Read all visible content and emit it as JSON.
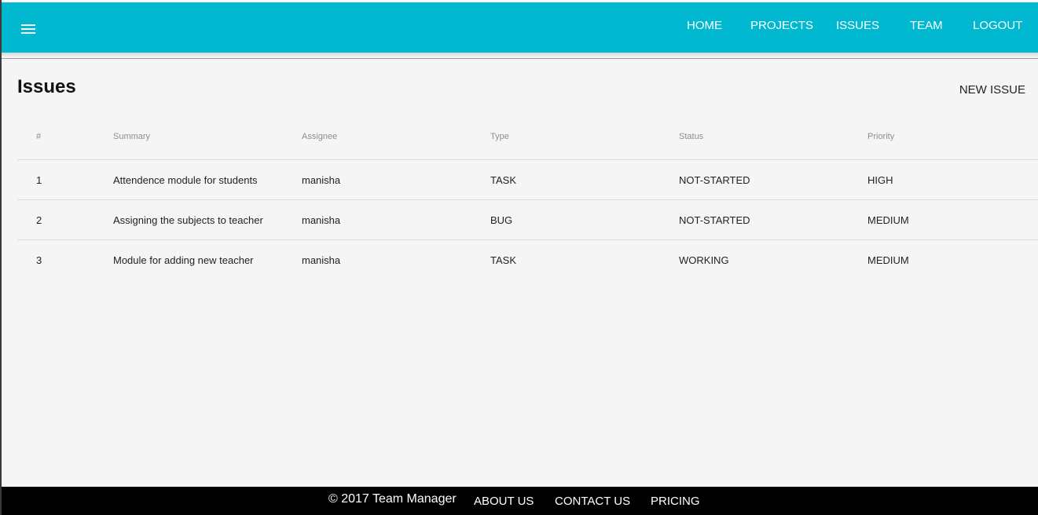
{
  "header": {
    "menu_icon": "hamburger-menu-icon",
    "nav": [
      "HOME",
      "PROJECTS",
      "ISSUES",
      "TEAM",
      "LOGOUT"
    ]
  },
  "page": {
    "title": "Issues",
    "new_issue_label": "NEW ISSUE"
  },
  "table": {
    "columns": [
      "#",
      "Summary",
      "Assignee",
      "Type",
      "Status",
      "Priority"
    ],
    "rows": [
      [
        "1",
        "Attendence module for students",
        "manisha",
        "TASK",
        "NOT-STARTED",
        "HIGH"
      ],
      [
        "2",
        "Assigning the subjects to teacher",
        "manisha",
        "BUG",
        "NOT-STARTED",
        "MEDIUM"
      ],
      [
        "3",
        "Module for adding new teacher",
        "manisha",
        "TASK",
        "WORKING",
        "MEDIUM"
      ]
    ]
  },
  "footer": {
    "copyright": "© 2017 Team Manager",
    "links": [
      "ABOUT US",
      "CONTACT US",
      "PRICING"
    ]
  },
  "colors": {
    "header_bg": "#00b8d0",
    "page_bg": "#f5f5f5",
    "footer_bg": "#000000"
  }
}
